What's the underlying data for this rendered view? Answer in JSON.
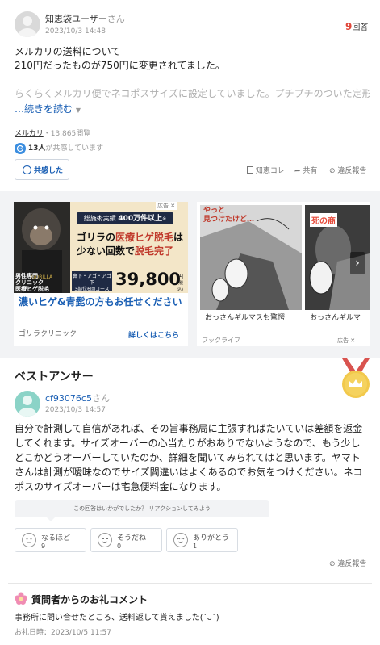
{
  "question": {
    "user_name": "知恵袋ユーザー",
    "user_suffix": "さん",
    "date": "2023/10/3 14:48",
    "answer_count": "9",
    "answer_count_label": "回答",
    "title_line1": "メルカリの送料について",
    "title_line2": "210円だったものが750円に変更されてました。",
    "excerpt": "らくらくメルカリ便でネコポスサイズに設定していました。プチプチのついた定形サ",
    "read_more": "…続きを読む",
    "category": "メルカリ",
    "views": "・13,865閲覧",
    "empathy_count": "13人",
    "empathy_text": "が共感しています",
    "empathy_button": "共感した",
    "actions": {
      "chiecore": "知恵コレ",
      "share": "共有",
      "report": "違反報告"
    }
  },
  "ads": {
    "left": {
      "ad_label": "広告",
      "badge_top": "総施術実績",
      "badge_num": "400万件以上",
      "badge_note": "※",
      "headline1_a": "ゴリラの",
      "headline1_b": "医療ヒゲ脱毛",
      "headline1_c": "は",
      "headline2_a": "少ない回数で",
      "headline2_b": "脱毛完了",
      "side1": "男性専門",
      "side2": "クリニック",
      "side3": "医療ヒゲ脱毛",
      "course": "鼻下・アゴ・アゴ下",
      "course2": "3部位6回コース",
      "price": "39,800",
      "price_unit": "円",
      "price_tax": "(税込)",
      "cta_text": "濃いヒゲ&青髭の方もお任せください",
      "advertiser": "ゴリラクリニック",
      "details": "詳しくはこちら"
    },
    "right": {
      "ad_label": "広告",
      "manga_title1": "やっと",
      "manga_title2": "見つけたけど…",
      "manga_tag": "死の商",
      "card1": "おっさんギルマスも驚愕",
      "card2": "おっさんギルマ",
      "brand": "ブックライブ"
    }
  },
  "best_answer": {
    "heading": "ベストアンサー",
    "user_name": "cf93076c5",
    "user_suffix": "さん",
    "date": "2023/10/3 14:57",
    "body": "自分で計測して自信があれば、その旨事務局に主張すればたいていは差額を返金してくれます。サイズオーバーの心当たりがおありでないようなので、もう少しどこかどうオーバーしていたのか、詳細を聞いてみられてはと思います。ヤマトさんは計測が曖昧なのでサイズ間違いはよくあるのでお気をつけください。ネコポスのサイズオーバーは宅急便料金になります。",
    "reaction_prompt": "この回答はいかがでしたか？ リアクションしてみよう",
    "reactions": [
      {
        "label": "なるほど",
        "count": "9"
      },
      {
        "label": "そうだね",
        "count": "0"
      },
      {
        "label": "ありがとう",
        "count": "1"
      }
    ],
    "report": "違反報告"
  },
  "thanks": {
    "heading": "質問者からのお礼コメント",
    "body": "事務所に問い合せたところ、送料返して貰えました(ˊᴗˋ)",
    "date": "お礼日時：2023/10/5 11:57"
  },
  "colors": {
    "accent_red": "#e0473a",
    "link_blue": "#1a5fb4",
    "gold": "#f2c94c"
  }
}
